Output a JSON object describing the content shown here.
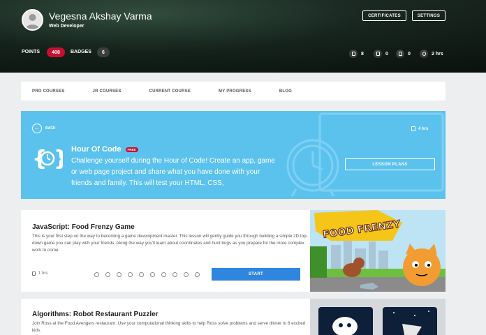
{
  "header": {
    "user_name": "Vegesna Akshay Varma",
    "user_role": "Web Developer",
    "certificates_label": "CERTIFICATES",
    "settings_label": "SETTINGS",
    "points_label": "POINTS",
    "points_value": "408",
    "badges_label": "BADGES",
    "badges_value": "6",
    "stats": [
      {
        "icon": "book-icon",
        "value": "8"
      },
      {
        "icon": "layout-icon",
        "value": "0"
      },
      {
        "icon": "quiz-icon",
        "value": "0"
      },
      {
        "icon": "watch-icon",
        "value": "2 hrs"
      }
    ]
  },
  "nav": {
    "items": [
      "PRO COURSES",
      "JR COURSES",
      "CURRENT COURSE",
      "MY PROGRESS",
      "BLOG"
    ]
  },
  "banner": {
    "back_label": "BACK",
    "title": "Hour Of Code",
    "badge": "FREE",
    "description": "Challenge yourself during the Hour of Code! Create an app, game or web page project and share what you have done with your friends and family. This will test your HTML, CSS,",
    "time": "4 hrs",
    "lesson_plans_label": "LESSON PLANS",
    "color": "#5bc2ee"
  },
  "courses": [
    {
      "title": "JavaScript: Food Frenzy Game",
      "description": "This is your first step on the way to becoming a game development master. This lesson will gently guide you through building a simple 2D top-down game you can play with your friends. Along the way you'll learn about coordinates and hunt bugs as you prepare for the more complex work to come.",
      "time": "1 hrs",
      "start_label": "START",
      "image_text": "FOOD FRENZY"
    },
    {
      "title": "Algorithms: Robot Restaurant Puzzler",
      "description": "Join Ross at the Food Avengers restaurant. Use your computational thinking skills to help Ross solve problems and serve dinner to 8 excited kids."
    }
  ],
  "colors": {
    "accent_red": "#c8102e",
    "start_blue": "#2e86de"
  }
}
